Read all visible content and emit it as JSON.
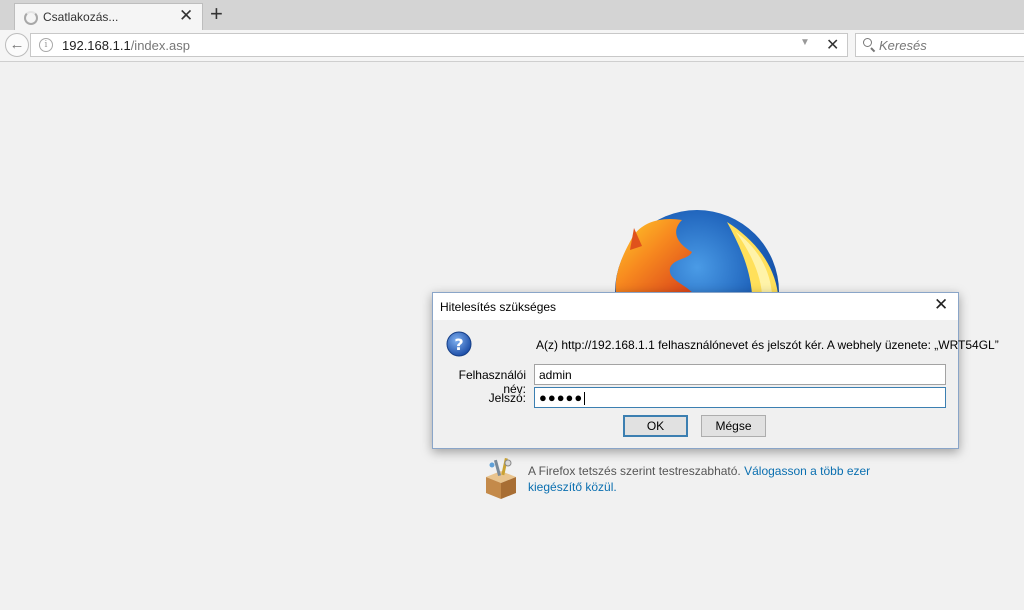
{
  "browser": {
    "tab": {
      "title": "Csatlakozás..."
    },
    "new_tab": "+",
    "close_glyph": "✕",
    "url": {
      "host": "192.168.1.1",
      "path": "/index.asp"
    },
    "search_placeholder": "Keresés",
    "icons": [
      "loading-spinner",
      "close-icon",
      "plus-icon",
      "back-arrow-icon",
      "info-icon",
      "dropdown-icon",
      "stop-icon",
      "search-icon"
    ]
  },
  "dialog": {
    "title": "Hitelesítés szükséges",
    "message": "A(z) http://192.168.1.1 felhasználónevet és jelszót kér. A webhely üzenete: „WRT54GL”",
    "username_label": "Felhasználói név:",
    "username_value": "admin",
    "password_label": "Jelszó:",
    "password_value": "●●●●●",
    "ok_label": "OK",
    "cancel_label": "Mégse"
  },
  "addons": {
    "text": "A Firefox tetszés szerint testreszabható. ",
    "link": "Válogasson a több ezer kiegészítő közül."
  }
}
